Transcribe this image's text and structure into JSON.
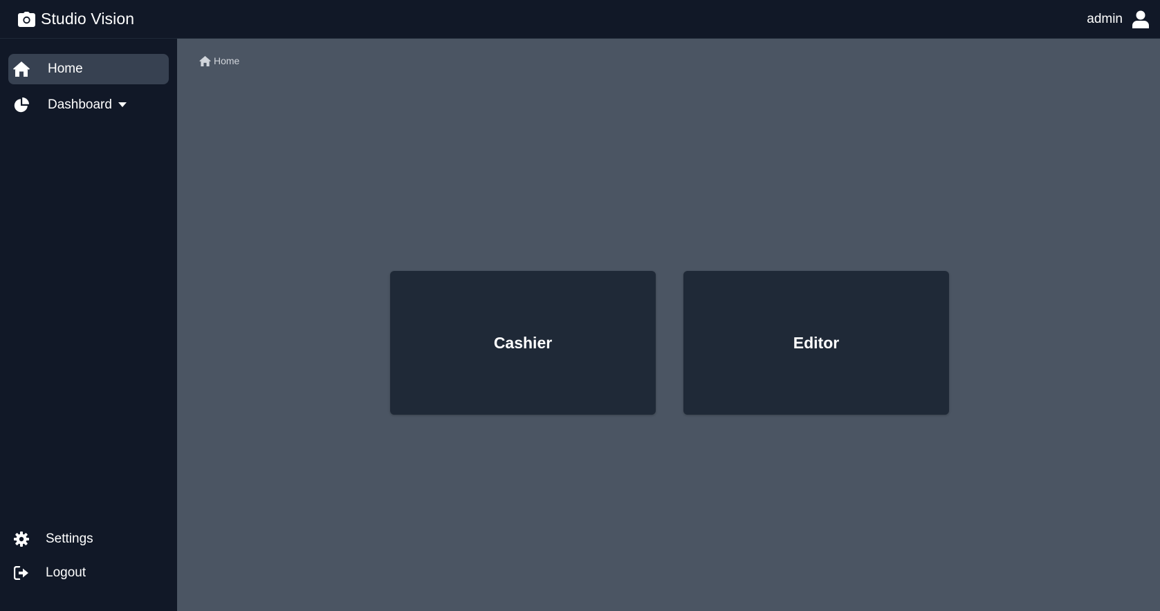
{
  "app": {
    "title": "Studio Vision",
    "logo_icon": "camera-icon"
  },
  "header": {
    "username": "admin",
    "user_icon": "user-icon"
  },
  "sidebar": {
    "items": [
      {
        "label": "Home",
        "icon": "home-icon",
        "active": true
      },
      {
        "label": "Dashboard",
        "icon": "pie-chart-icon",
        "has_dropdown": true
      }
    ],
    "bottom_items": [
      {
        "label": "Settings",
        "icon": "gear-icon"
      },
      {
        "label": "Logout",
        "icon": "logout-icon"
      }
    ]
  },
  "breadcrumb": {
    "label": "Home",
    "icon": "home-icon"
  },
  "cards": [
    {
      "label": "Cashier"
    },
    {
      "label": "Editor"
    }
  ],
  "colors": {
    "topbar": "#111827",
    "sidebar": "#111827",
    "content": "#4b5563",
    "card": "#1f2937",
    "active_item": "#374151"
  }
}
